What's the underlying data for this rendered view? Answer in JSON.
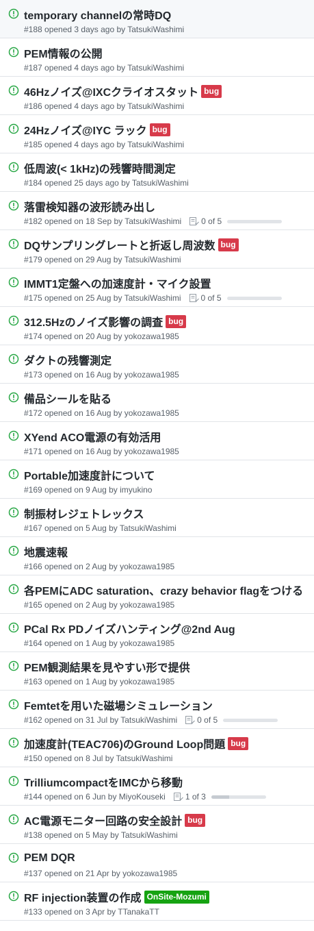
{
  "colors": {
    "open_icon": "#28a745",
    "bug_label": "#d73a4a",
    "onsite_label": "#16a312",
    "title_text": "#24292e",
    "meta_text": "#586069"
  },
  "issues": [
    {
      "title": "temporary channelの常時DQ",
      "meta": "#188 opened 3 days ago by TatsukiWashimi"
    },
    {
      "title": "PEM情報の公開",
      "meta": "#187 opened 4 days ago by TatsukiWashimi"
    },
    {
      "title": "46Hzノイズ@IXCクライオスタット",
      "label": "bug",
      "label_color": "#d73a4a",
      "meta": "#186 opened 4 days ago by TatsukiWashimi"
    },
    {
      "title": "24Hzノイズ@IYC ラック",
      "label": "bug",
      "label_color": "#d73a4a",
      "meta": "#185 opened 4 days ago by TatsukiWashimi"
    },
    {
      "title": "低周波(< 1kHz)の残響時間測定",
      "meta": "#184 opened 25 days ago by TatsukiWashimi"
    },
    {
      "title": "落雷検知器の波形読み出し",
      "meta": "#182 opened on 18 Sep by TatsukiWashimi",
      "tasks": "0 of 5",
      "progress": 0
    },
    {
      "title": "DQサンプリングレートと折返し周波数",
      "label": "bug",
      "label_color": "#d73a4a",
      "meta": "#179 opened on 29 Aug by TatsukiWashimi"
    },
    {
      "title": "IMMT1定盤への加速度計・マイク設置",
      "meta": "#175 opened on 25 Aug by TatsukiWashimi",
      "tasks": "0 of 5",
      "progress": 0
    },
    {
      "title": "312.5Hzのノイズ影響の調査",
      "label": "bug",
      "label_color": "#d73a4a",
      "meta": "#174 opened on 20 Aug by yokozawa1985"
    },
    {
      "title": "ダクトの残響測定",
      "meta": "#173 opened on 16 Aug by yokozawa1985"
    },
    {
      "title": "備品シールを貼る",
      "meta": "#172 opened on 16 Aug by yokozawa1985"
    },
    {
      "title": "XYend ACO電源の有効活用",
      "meta": "#171 opened on 16 Aug by yokozawa1985"
    },
    {
      "title": "Portable加速度計について",
      "meta": "#169 opened on 9 Aug by imyukino"
    },
    {
      "title": "制振材レジェトレックス",
      "meta": "#167 opened on 5 Aug by TatsukiWashimi"
    },
    {
      "title": "地震速報",
      "meta": "#166 opened on 2 Aug by yokozawa1985"
    },
    {
      "title": "各PEMにADC saturation、crazy behavior flagをつける",
      "meta": "#165 opened on 2 Aug by yokozawa1985"
    },
    {
      "title": "PCal Rx PDノイズハンティング@2nd Aug",
      "meta": "#164 opened on 1 Aug by yokozawa1985"
    },
    {
      "title": "PEM観測結果を見やすい形で提供",
      "meta": "#163 opened on 1 Aug by yokozawa1985"
    },
    {
      "title": "Femtetを用いた磁場シミュレーション",
      "meta": "#162 opened on 31 Jul by TatsukiWashimi",
      "tasks": "0 of 5",
      "progress": 0
    },
    {
      "title": "加速度計(TEAC706)のGround Loop問題",
      "label": "bug",
      "label_color": "#d73a4a",
      "meta": "#150 opened on 8 Jul by TatsukiWashimi"
    },
    {
      "title": "TrilliumcompactをIMCから移動",
      "meta": "#144 opened on 6 Jun by MiyoKouseki",
      "tasks": "1 of 3",
      "progress": 0.333
    },
    {
      "title": "AC電源モニター回路の安全設計",
      "label": "bug",
      "label_color": "#d73a4a",
      "meta": "#138 opened on 5 May by TatsukiWashimi"
    },
    {
      "title": "PEM DQR",
      "meta": "#137 opened on 21 Apr by yokozawa1985"
    },
    {
      "title": "RF injection装置の作成",
      "label": "OnSite-Mozumi",
      "label_color": "#16a312",
      "meta": "#133 opened on 3 Apr by TTanakaTT"
    }
  ]
}
